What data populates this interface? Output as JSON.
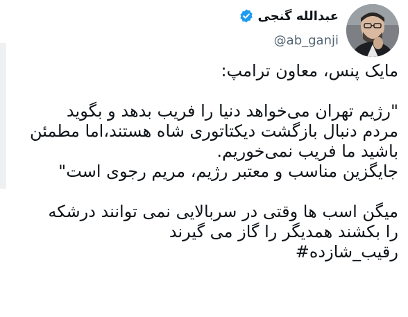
{
  "author": {
    "display_name": "عبدالله گنجی",
    "handle": "@ab_ganji",
    "verified": true
  },
  "tweet": {
    "lines": [
      "مایک پنس، معاون ترامپ:",
      "\"رژیم تهران می‌خواهد دنیا را فریب بدهد و بگوید",
      "مردم دنبال بازگشت دیکتاتوری شاه هستند،اما مطمئن",
      "باشید ما فریب نمی‌خوریم.",
      "جایگزین مناسب و معتبر رژیم، مریم رجوی است\"",
      "میگن اسب ها وقتی در سربالایی نمی توانند درشکه",
      "را بکشند همدیگر را گاز می گیرند",
      "رقیب_شازده#"
    ]
  },
  "colors": {
    "text": "#0f1419",
    "secondary": "#536471",
    "verified": "#1d9bf0"
  },
  "icons": {
    "verified": "verified-badge-icon",
    "avatar": "user-avatar"
  }
}
